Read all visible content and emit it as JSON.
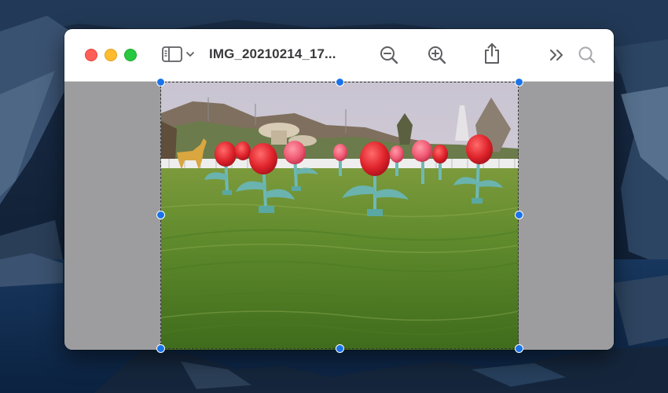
{
  "window": {
    "title": "IMG_20210214_17...",
    "traffic_lights": [
      "close",
      "minimize",
      "zoom"
    ]
  },
  "toolbar": {
    "icons": [
      "sidebar-icon",
      "chevron-down-icon",
      "zoom-out-icon",
      "zoom-in-icon",
      "share-icon",
      "more-tools-icon",
      "search-icon"
    ]
  },
  "colors": {
    "close": "#ff5f57",
    "minimize": "#febc2e",
    "zoom": "#28c840",
    "selection_handle": "#1a73e8",
    "canvas_background": "#9d9d9f"
  }
}
